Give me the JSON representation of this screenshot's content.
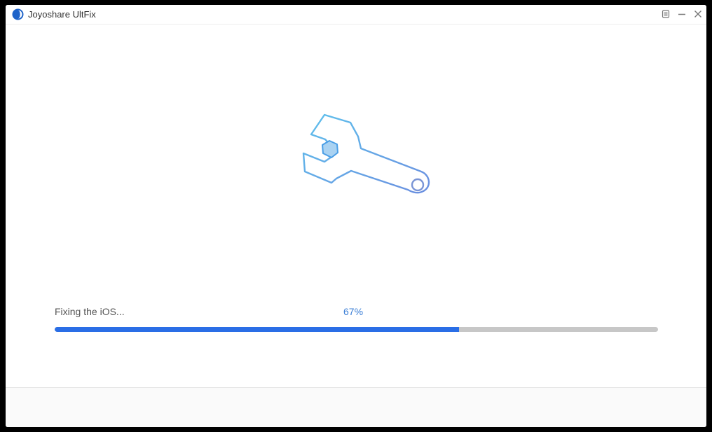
{
  "window": {
    "title": "Joyoshare UltFix",
    "logo_icon": "joyoshare-logo-icon",
    "controls": {
      "menu_icon": "menu-icon",
      "minimize_icon": "minimize-icon",
      "close_icon": "close-icon"
    }
  },
  "main": {
    "illustration_icon": "wrench-icon",
    "status_text": "Fixing the iOS...",
    "progress_text": "67%",
    "progress_value": 0.67
  },
  "colors": {
    "accent": "#2a6ee6",
    "icon_stroke": "#5bb8ea",
    "track": "#c7c7c7",
    "percent_text": "#3c7fd6"
  }
}
